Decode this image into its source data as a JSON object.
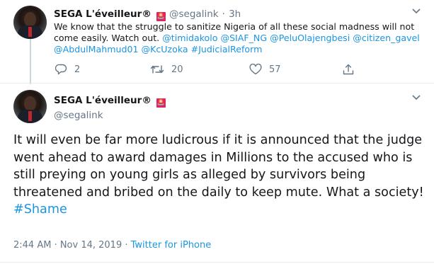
{
  "tweet1": {
    "display_name": "SEGA L'éveilleur®",
    "badge": "🚨",
    "handle": "@segalink",
    "separator": "·",
    "time": "3h",
    "text_plain": "We know that the struggle to sanitize Nigeria of all these social madness will not come easily. Watch out. ",
    "mentions": [
      "@timidakolo",
      "@SIAF_NG",
      "@PeluOlajengbesi",
      "@citizen_gavel",
      "@AbdulMahmud01",
      "@KcUzoka"
    ],
    "hashtag": "#JudicialReform",
    "counts": {
      "replies": "2",
      "retweets": "20",
      "likes": "57"
    }
  },
  "tweet2": {
    "display_name": "SEGA L'éveilleur®",
    "badge": "🚨",
    "handle": "@segalink",
    "text_plain": "It will even be far more ludicrous if it is announced that the judge went ahead to award damages in Millions to the accused who is still preying on young girls as alleged by survivors being threatened and bribed on the daily to keep mute. What a society! ",
    "hashtag": "#Shame",
    "timestamp": "2:44 AM · Nov 14, 2019",
    "meta_separator": " · ",
    "source": "Twitter for iPhone"
  },
  "icons": {
    "reply": "reply-icon",
    "retweet": "retweet-icon",
    "like": "heart-icon",
    "share": "share-icon",
    "more": "chevron-down-icon"
  },
  "colors": {
    "link": "#1b95e0",
    "muted": "#657786",
    "text": "#14171a",
    "badge": "#e0245e"
  }
}
